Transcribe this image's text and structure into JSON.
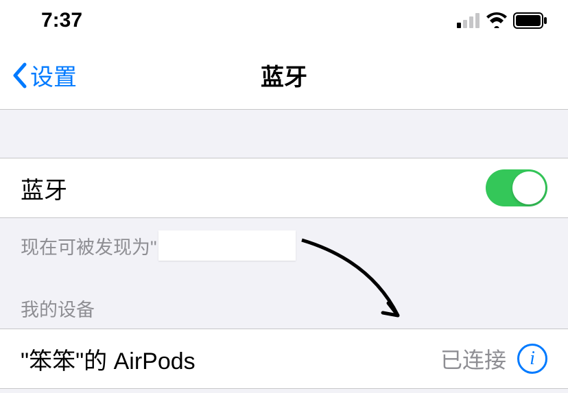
{
  "statusBar": {
    "time": "7:37"
  },
  "nav": {
    "backLabel": "设置",
    "title": "蓝牙"
  },
  "bluetooth": {
    "label": "蓝牙",
    "enabled": true
  },
  "discoverable": {
    "prefix": "现在可被发现为\""
  },
  "devices": {
    "sectionHeader": "我的设备",
    "items": [
      {
        "name": "\"笨笨\"的 AirPods",
        "status": "已连接"
      }
    ]
  }
}
